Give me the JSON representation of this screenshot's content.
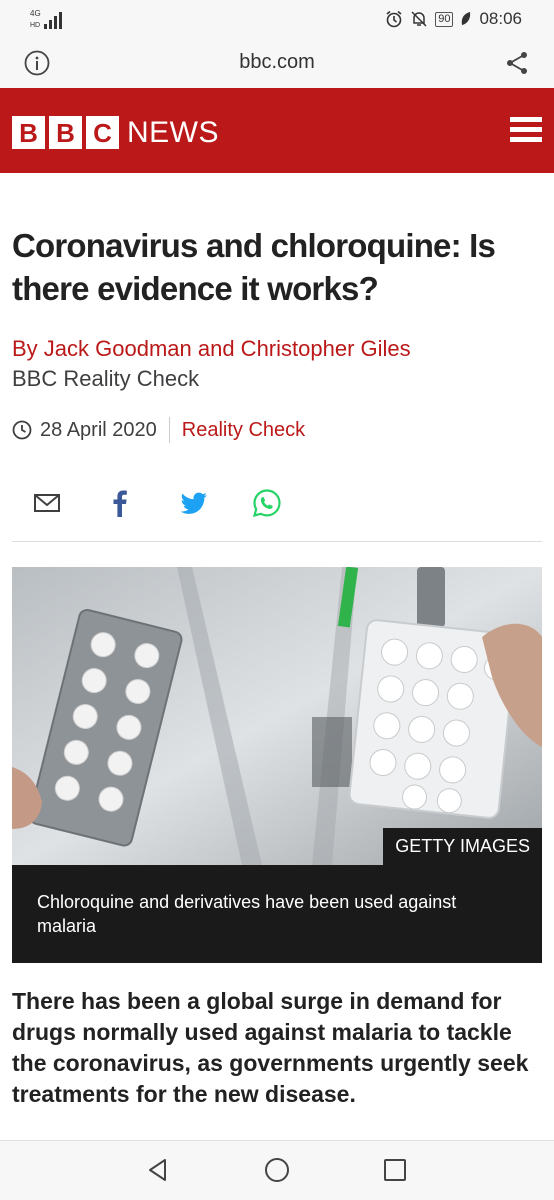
{
  "status": {
    "network": "4G",
    "battery": "90",
    "time": "08:06"
  },
  "browser": {
    "url": "bbc.com"
  },
  "brand": {
    "logo_letters": [
      "B",
      "B",
      "C"
    ],
    "news_label": "NEWS",
    "color": "#bb1919"
  },
  "article": {
    "headline": "Coronavirus and chloroquine: Is there evidence it works?",
    "byline": "By Jack Goodman and Christopher Giles",
    "byline_role": "BBC Reality Check",
    "date": "28 April 2020",
    "topic": "Reality Check",
    "image_credit": "GETTY IMAGES",
    "image_caption": "Chloroquine and derivatives have been used against malaria",
    "intro": "There has been a global surge in demand for drugs normally used against malaria to tackle the coronavirus, as governments urgently seek treatments for the new disease."
  },
  "share": [
    "email-icon",
    "facebook-icon",
    "twitter-icon",
    "whatsapp-icon"
  ],
  "navbar": [
    "back-icon",
    "home-icon",
    "recents-icon"
  ]
}
